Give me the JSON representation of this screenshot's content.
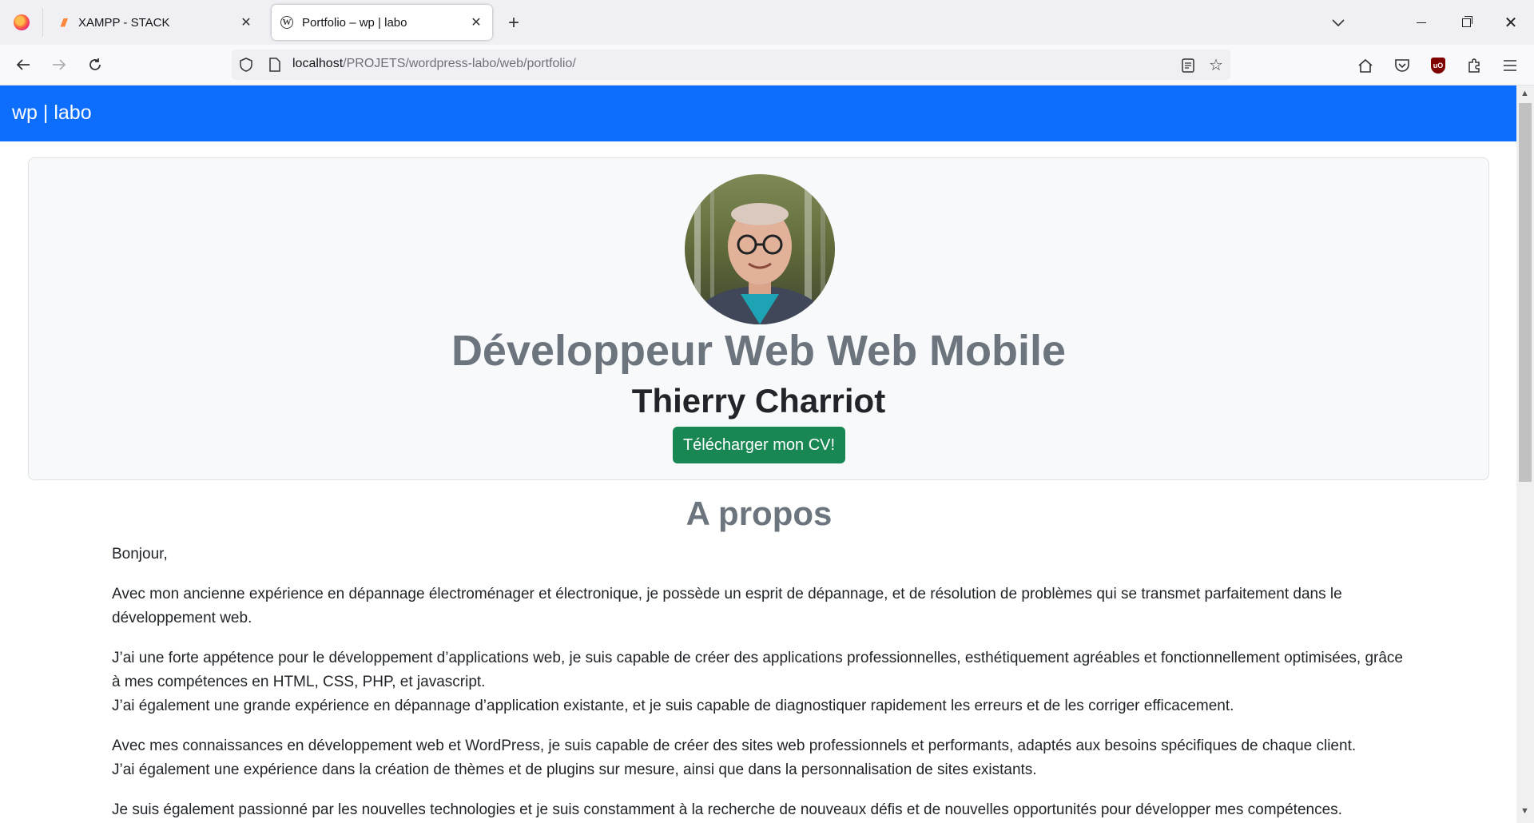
{
  "browser": {
    "tabs": [
      {
        "title": "XAMPP - STACK",
        "active": false,
        "favicon": "xampp-icon"
      },
      {
        "title": "Portfolio – wp | labo",
        "active": true,
        "favicon": "wordpress-icon"
      }
    ],
    "url": {
      "host": "localhost",
      "path": "/PROJETS/wordpress-labo/web/portfolio/"
    }
  },
  "site": {
    "brand": "wp | labo",
    "header_color": "#0d6efd"
  },
  "hero": {
    "title": "Développeur Web Web Mobile",
    "name": "Thierry Charriot",
    "cv_button": "Télécharger mon CV!",
    "button_color": "#198754"
  },
  "about": {
    "heading": "A propos",
    "paragraphs": [
      {
        "lines": [
          "Bonjour,"
        ]
      },
      {
        "lines": [
          "Avec mon ancienne expérience en dépannage électroménager et électronique, je possède un esprit de dépannage, et de résolution de problèmes qui se transmet parfaitement dans le développement web."
        ]
      },
      {
        "lines": [
          "J’ai une forte appétence pour le développement d’applications web, je suis capable de créer des applications professionnelles, esthétiquement agréables et fonctionnellement optimisées, grâce à mes compétences en HTML, CSS, PHP, et javascript.",
          "J’ai également une grande expérience en dépannage d’application existante, et je suis capable de diagnostiquer rapidement les erreurs et de les corriger efficacement."
        ]
      },
      {
        "lines": [
          "Avec mes connaissances en développement web et WordPress, je suis capable de créer des sites web professionnels et performants, adaptés aux besoins spécifiques de chaque client.",
          "J’ai également une expérience dans la création de thèmes et de plugins sur mesure, ainsi que dans la personnalisation de sites existants."
        ]
      },
      {
        "lines": [
          "Je suis également passionné par les nouvelles technologies et je suis constamment à la recherche de nouveaux défis et de nouvelles opportunités pour développer mes compétences."
        ]
      }
    ]
  }
}
